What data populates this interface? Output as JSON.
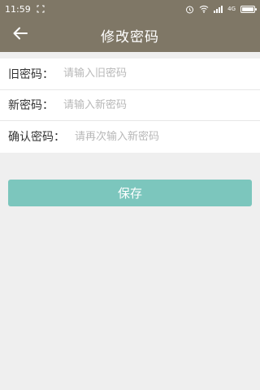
{
  "status_bar": {
    "time": "11:59",
    "network_label": "4G"
  },
  "header": {
    "title": "修改密码"
  },
  "form": {
    "fields": [
      {
        "label": "旧密码：",
        "placeholder": "请输入旧密码",
        "value": ""
      },
      {
        "label": "新密码：",
        "placeholder": "请输入新密码",
        "value": ""
      },
      {
        "label": "确认密码：",
        "placeholder": "请再次输入新密码",
        "value": ""
      }
    ]
  },
  "actions": {
    "save_label": "保存"
  },
  "colors": {
    "header_bg": "#7f7766",
    "page_bg": "#efefef",
    "button_bg": "#7cc6bd"
  }
}
